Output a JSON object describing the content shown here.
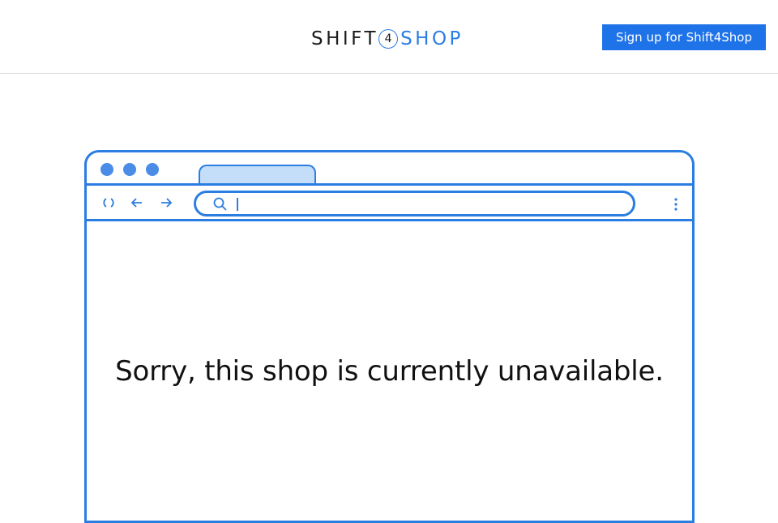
{
  "header": {
    "logo": {
      "part_a": "SHIFT",
      "four": "4",
      "part_b": "SHOP"
    },
    "signup_label": "Sign up for Shift4Shop"
  },
  "illustration": {
    "message": "Sorry, this shop is currently unavailable.",
    "icons": [
      "reload-icon",
      "back-arrow-icon",
      "forward-arrow-icon",
      "search-icon",
      "kebab-menu-icon"
    ]
  },
  "colors": {
    "accent": "#2a7de1",
    "button": "#1f73e8",
    "tab_fill": "#c4def9",
    "text": "#111111"
  }
}
